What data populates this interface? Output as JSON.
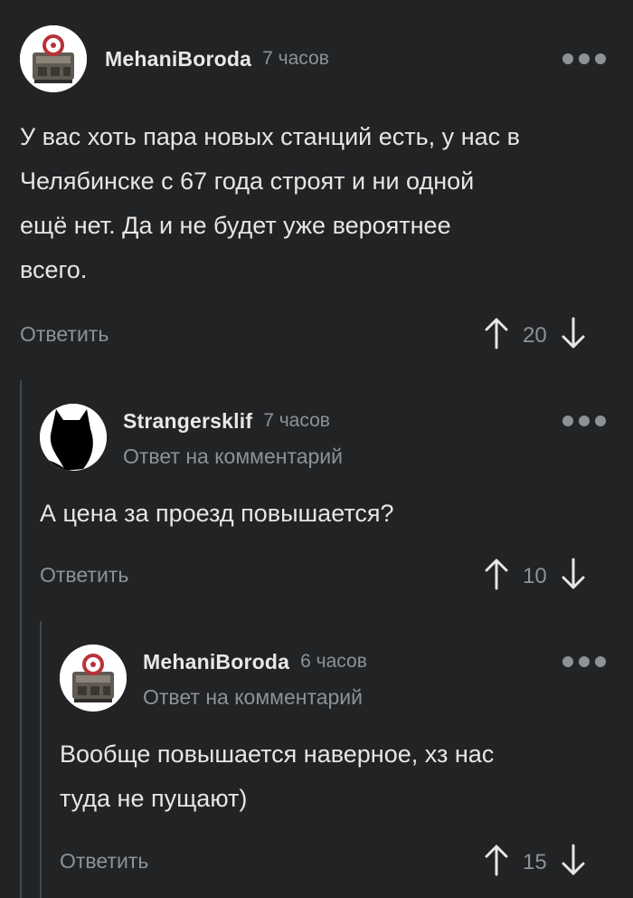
{
  "comments": [
    {
      "username": "MehaniBoroda",
      "time": "7 часов",
      "subline": "",
      "text": "У вас хоть пара новых станций есть, у нас в\nЧелябинске с 67 года строят и ни одной\nещё нет. Да и не будет уже вероятнее\nвсего.",
      "reply_label": "Ответить",
      "score": "20",
      "avatar_icon": "engine-photo"
    },
    {
      "username": "Strangersklif",
      "time": "7 часов",
      "subline": "Ответ на комментарий",
      "text": "А цена за проезд повышается?",
      "reply_label": "Ответить",
      "score": "10",
      "avatar_icon": "cat-silhouette"
    },
    {
      "username": "MehaniBoroda",
      "time": "6 часов",
      "subline": "Ответ на комментарий",
      "text": "Вообще повышается наверное, хз нас\nтуда не пущают)",
      "reply_label": "Ответить",
      "score": "15",
      "avatar_icon": "engine-photo"
    }
  ],
  "colors": {
    "background": "#212325",
    "text": "#e6e6e6",
    "muted": "#8f9294",
    "thread_line": "#45484b"
  }
}
